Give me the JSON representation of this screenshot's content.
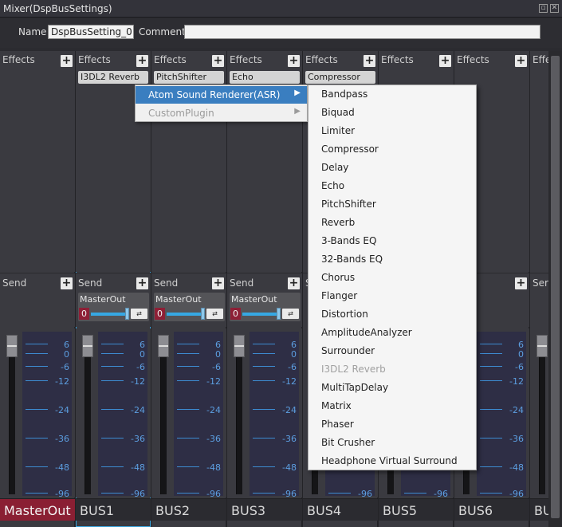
{
  "window": {
    "title": "Mixer(DspBusSettings)"
  },
  "settings": {
    "name_label": "Name",
    "name_value": "DspBusSetting_0",
    "comment_label": "Comment",
    "comment_value": ""
  },
  "buses": [
    {
      "name": "MasterOut",
      "effects_label": "Effects",
      "effect": "",
      "send_label": "Send",
      "send_dest": "",
      "send_level": ""
    },
    {
      "name": "BUS1",
      "effects_label": "Effects",
      "effect": "I3DL2 Reverb",
      "send_label": "Send",
      "send_dest": "MasterOut",
      "send_level": "0"
    },
    {
      "name": "BUS2",
      "effects_label": "Effects",
      "effect": "PitchShifter",
      "send_label": "Send",
      "send_dest": "MasterOut",
      "send_level": "0"
    },
    {
      "name": "BUS3",
      "effects_label": "Effects",
      "effect": "Echo",
      "send_label": "Send",
      "send_dest": "MasterOut",
      "send_level": "0"
    },
    {
      "name": "BUS4",
      "effects_label": "Effects",
      "effect": "Compressor",
      "send_label": "S",
      "send_dest": "",
      "send_level": ""
    },
    {
      "name": "BUS5",
      "effects_label": "Effects",
      "effect": "",
      "send_label": "",
      "send_dest": "",
      "send_level": ""
    },
    {
      "name": "BUS6",
      "effects_label": "Effects",
      "effect": "",
      "send_label": "",
      "send_dest": "",
      "send_level": ""
    },
    {
      "name": "BU",
      "effects_label": "Effe",
      "effect": "",
      "send_label": "Ser",
      "send_dest": "",
      "send_level": ""
    }
  ],
  "meter_scale": [
    "6",
    "0",
    "-6",
    "-12",
    "-24",
    "-36",
    "-48",
    "-96"
  ],
  "menu1": {
    "items": [
      {
        "label": "Atom Sound Renderer(ASR)",
        "state": "active"
      },
      {
        "label": "CustomPlugin",
        "state": "disabled"
      }
    ]
  },
  "menu2": {
    "items": [
      {
        "label": "Bandpass",
        "state": "enabled"
      },
      {
        "label": "Biquad",
        "state": "enabled"
      },
      {
        "label": "Limiter",
        "state": "enabled"
      },
      {
        "label": "Compressor",
        "state": "enabled"
      },
      {
        "label": "Delay",
        "state": "enabled"
      },
      {
        "label": "Echo",
        "state": "enabled"
      },
      {
        "label": "PitchShifter",
        "state": "enabled"
      },
      {
        "label": "Reverb",
        "state": "enabled"
      },
      {
        "label": "3-Bands EQ",
        "state": "enabled"
      },
      {
        "label": "32-Bands EQ",
        "state": "enabled"
      },
      {
        "label": "Chorus",
        "state": "enabled"
      },
      {
        "label": "Flanger",
        "state": "enabled"
      },
      {
        "label": "Distortion",
        "state": "enabled"
      },
      {
        "label": "AmplitudeAnalyzer",
        "state": "enabled"
      },
      {
        "label": "Surrounder",
        "state": "enabled"
      },
      {
        "label": "I3DL2 Reverb",
        "state": "disabled"
      },
      {
        "label": "MultiTapDelay",
        "state": "enabled"
      },
      {
        "label": "Matrix",
        "state": "enabled"
      },
      {
        "label": "Phaser",
        "state": "enabled"
      },
      {
        "label": "Bit Crusher",
        "state": "enabled"
      },
      {
        "label": "Headphone Virtual Surround",
        "state": "enabled"
      }
    ]
  },
  "icons": {
    "plus": "plus-icon",
    "submenu": "chevron-right-icon",
    "route": "route-icon",
    "maximize": "maximize-icon",
    "close": "close-icon"
  },
  "colors": {
    "accent": "#3a7ec0",
    "master_red": "#8a1f33",
    "selection_outline": "#3aa7e0",
    "meter_blue": "#5c9ee0"
  }
}
